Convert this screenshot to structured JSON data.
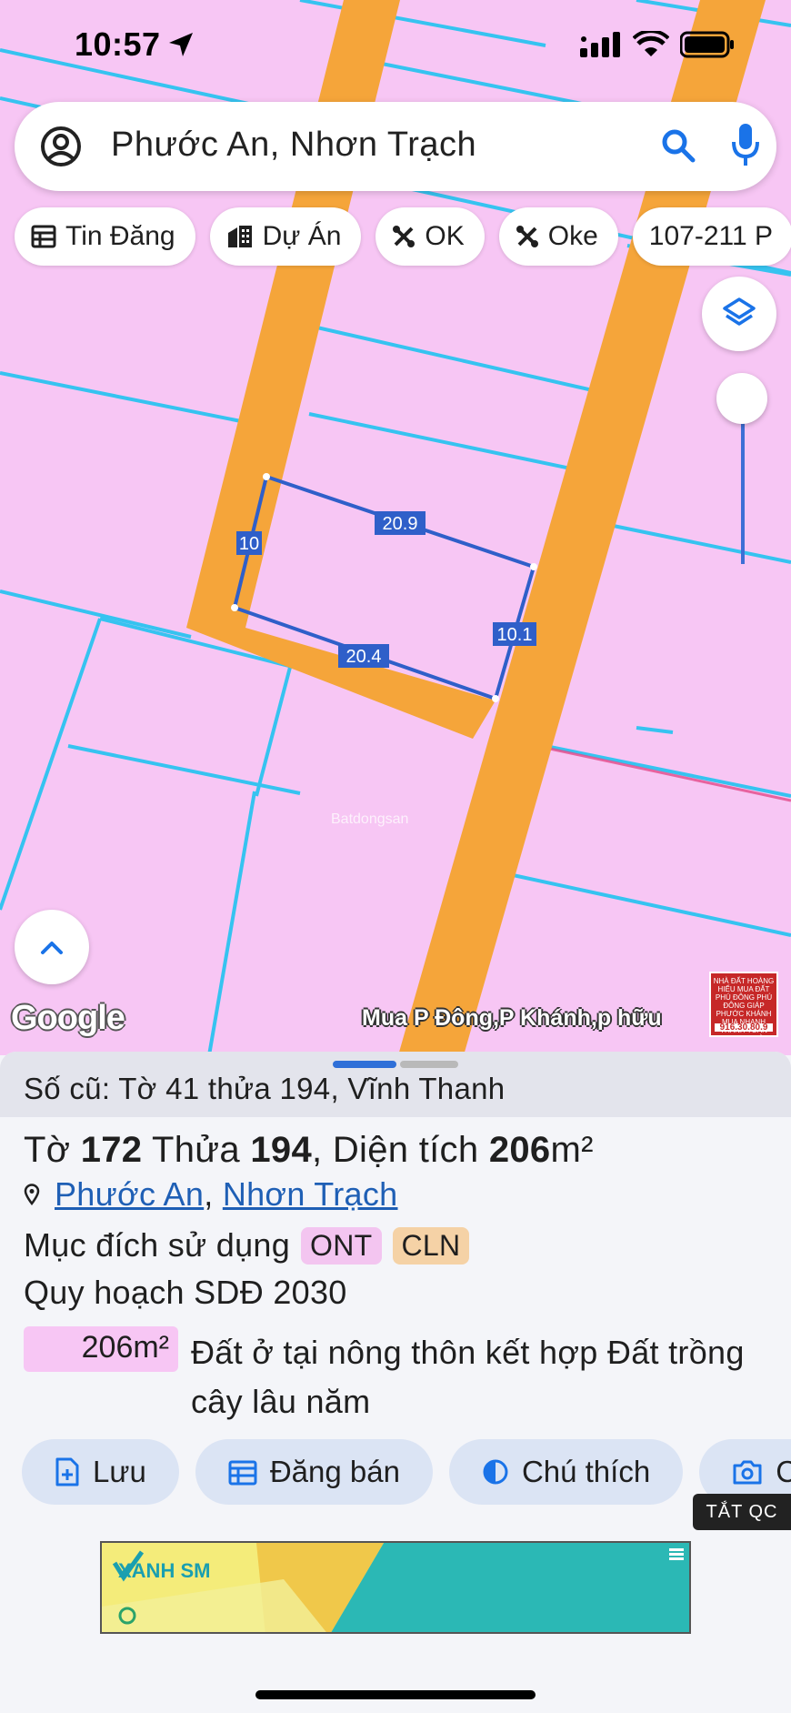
{
  "status_bar": {
    "time": "10:57"
  },
  "search": {
    "query": "Phước An, Nhơn Trạch"
  },
  "chips": [
    {
      "label": "Tin Đăng",
      "icon": "list-icon"
    },
    {
      "label": "Dự Án",
      "icon": "building-icon"
    },
    {
      "label": "OK",
      "icon": "tools-icon"
    },
    {
      "label": "Oke",
      "icon": "tools-icon"
    },
    {
      "label": "107-211 P",
      "icon": ""
    }
  ],
  "map": {
    "lot_dimensions": {
      "top": "20.9",
      "left": "10",
      "right": "10.1",
      "bottom": "20.4"
    },
    "google_logo": "Google",
    "ad_caption": "Mua P Đông,P Khánh,p hữu",
    "ad_thumb_text": "NHÀ ĐẤT HOÀNG HIẾU MUA ĐẤT PHÚ ĐÔNG PHÚ ĐÔNG GIÁP PHƯỚC KHÁNH MUA NHANH THANH TOÁN TRONG NGÀY",
    "ad_thumb_phone": "916.30.80.9",
    "watermark": "Batdongsan",
    "colors": {
      "land": "#f7c6f4",
      "road": "#f5a53a",
      "parcel_line": "#36c3f0",
      "selection": "#2f5fc9"
    }
  },
  "sheet": {
    "old_parcel": "Số cũ: Tờ 41 thửa 194, Vĩnh Thanh",
    "parcel": {
      "sheet_label": "Tờ",
      "sheet_no": "172",
      "lot_label": "Thửa",
      "lot_no": "194",
      "area_label": "Diện tích",
      "area_value": "206",
      "area_unit": "m²"
    },
    "location": {
      "ward": "Phước An",
      "district": "Nhơn Trạch"
    },
    "purpose_label": "Mục đích sử dụng",
    "purpose_tags": [
      "ONT",
      "CLN"
    ],
    "plan_label": "Quy hoạch SDĐ 2030",
    "plan_area": "206m²",
    "plan_description": "Đất ở tại nông thôn kết hợp Đất trồng cây lâu năm",
    "actions": [
      {
        "label": "Lưu",
        "icon": "save-file-icon"
      },
      {
        "label": "Đăng bán",
        "icon": "calendar-icon"
      },
      {
        "label": "Chú thích",
        "icon": "contrast-icon"
      },
      {
        "label": "C",
        "icon": "camera-icon"
      }
    ],
    "hide_ads": "TẮT QC",
    "banner_brand": "XANH SM"
  }
}
